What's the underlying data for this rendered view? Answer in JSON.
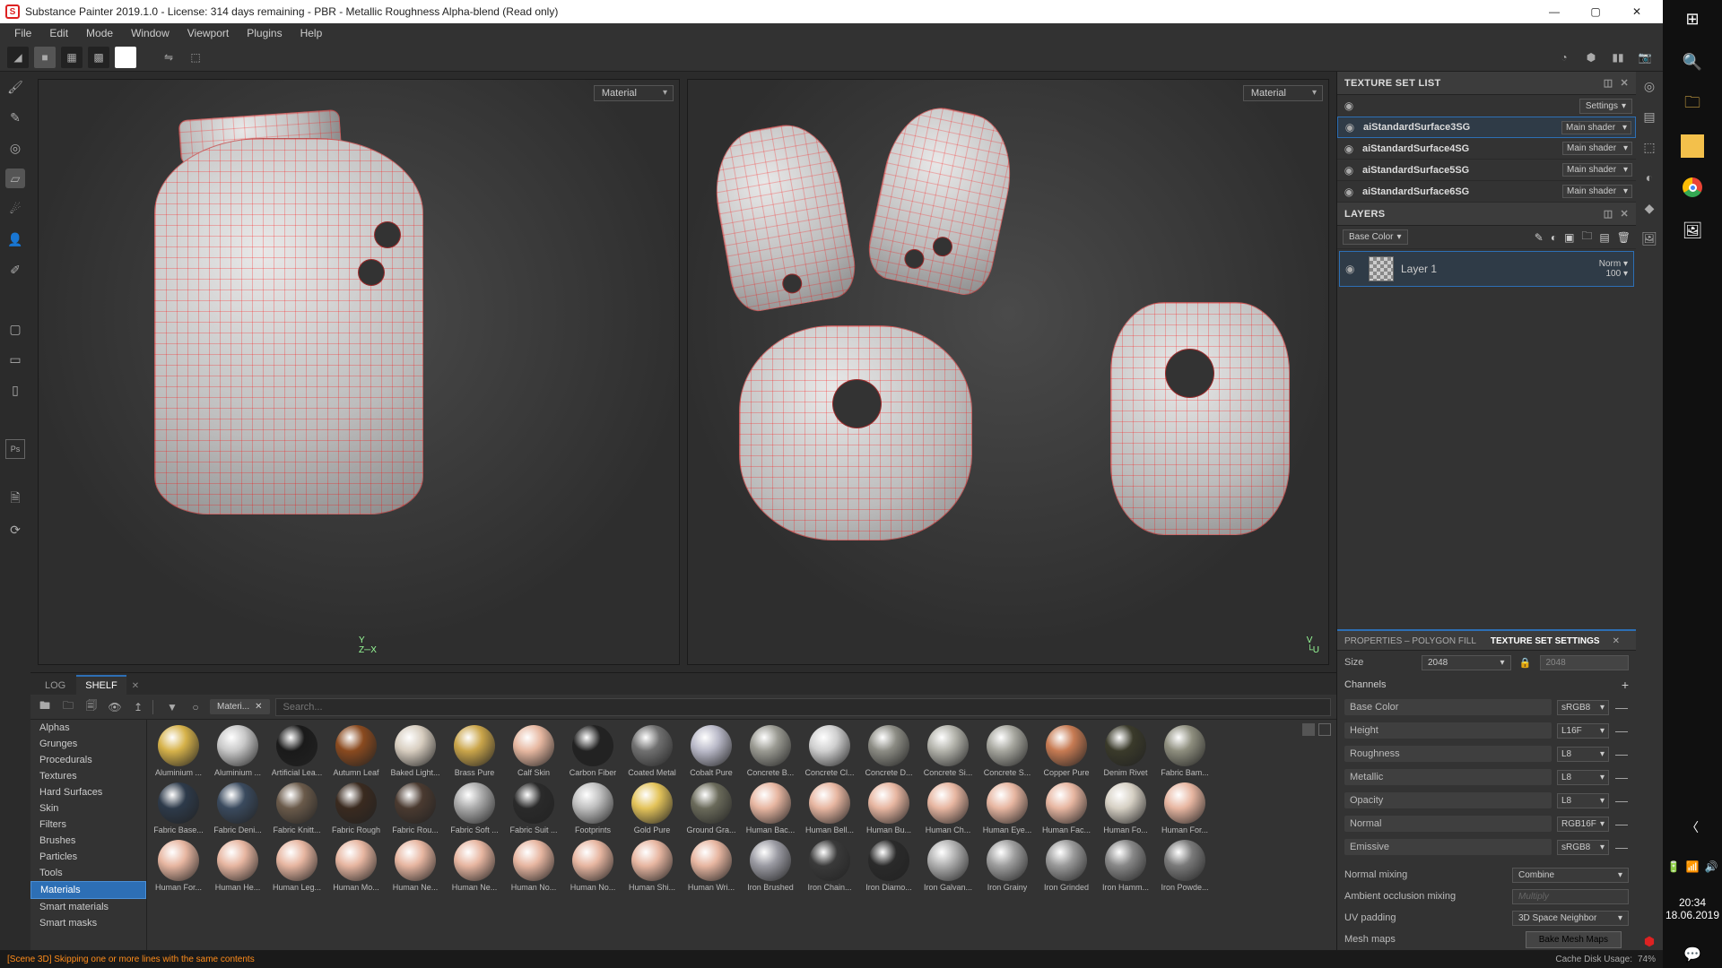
{
  "title": "Substance Painter 2019.1.0 - License: 314 days remaining - PBR - Metallic Roughness Alpha-blend (Read only)",
  "menu": [
    "File",
    "Edit",
    "Mode",
    "Window",
    "Viewport",
    "Plugins",
    "Help"
  ],
  "viewport": {
    "dd3d": "Material",
    "dd2d": "Material"
  },
  "texture_set_list": {
    "title": "TEXTURE SET LIST",
    "settings": "Settings",
    "items": [
      {
        "name": "aiStandardSurface3SG",
        "shader": "Main shader"
      },
      {
        "name": "aiStandardSurface4SG",
        "shader": "Main shader"
      },
      {
        "name": "aiStandardSurface5SG",
        "shader": "Main shader"
      },
      {
        "name": "aiStandardSurface6SG",
        "shader": "Main shader"
      }
    ]
  },
  "layers": {
    "title": "LAYERS",
    "channel": "Base Color",
    "layer_name": "Layer 1",
    "blend": "Norm",
    "opacity": "100"
  },
  "props": {
    "tab1": "PROPERTIES – POLYGON FILL",
    "tab2": "TEXTURE SET SETTINGS",
    "size_label": "Size",
    "size_val": "2048",
    "size_linked": "2048",
    "channels_label": "Channels",
    "channels": [
      {
        "name": "Base Color",
        "fmt": "sRGB8"
      },
      {
        "name": "Height",
        "fmt": "L16F"
      },
      {
        "name": "Roughness",
        "fmt": "L8"
      },
      {
        "name": "Metallic",
        "fmt": "L8"
      },
      {
        "name": "Opacity",
        "fmt": "L8"
      },
      {
        "name": "Normal",
        "fmt": "RGB16F"
      },
      {
        "name": "Emissive",
        "fmt": "sRGB8"
      }
    ],
    "normal_mixing_label": "Normal mixing",
    "normal_mixing": "Combine",
    "ao_label": "Ambient occlusion mixing",
    "ao_val": "Multiply",
    "uv_label": "UV padding",
    "uv_val": "3D Space Neighbor",
    "mesh_label": "Mesh maps",
    "bake": "Bake Mesh Maps"
  },
  "shelf": {
    "tab_log": "LOG",
    "tab_shelf": "SHELF",
    "filter_chip": "Materi...",
    "search_placeholder": "Search...",
    "categories": [
      "Alphas",
      "Grunges",
      "Procedurals",
      "Textures",
      "Hard Surfaces",
      "Skin",
      "Filters",
      "Brushes",
      "Particles",
      "Tools",
      "Materials",
      "Smart materials",
      "Smart masks"
    ],
    "selected_cat": "Materials",
    "rows": [
      [
        {
          "n": "Aluminium ...",
          "c": "#d6b24a"
        },
        {
          "n": "Aluminium ...",
          "c": "#c8c8c8"
        },
        {
          "n": "Artificial Lea...",
          "c": "#1a1a1a"
        },
        {
          "n": "Autumn Leaf",
          "c": "#8a4a1f"
        },
        {
          "n": "Baked Light...",
          "c": "#d7cdbf"
        },
        {
          "n": "Brass Pure",
          "c": "#caa54a"
        },
        {
          "n": "Calf Skin",
          "c": "#e6b7a0"
        },
        {
          "n": "Carbon Fiber",
          "c": "#222"
        },
        {
          "n": "Coated Metal",
          "c": "#707070"
        },
        {
          "n": "Cobalt Pure",
          "c": "#b9b9c8"
        },
        {
          "n": "Concrete B...",
          "c": "#9a9a92"
        },
        {
          "n": "Concrete Cl...",
          "c": "#cfcfcf"
        },
        {
          "n": "Concrete D...",
          "c": "#8c8c84"
        },
        {
          "n": "Concrete Si...",
          "c": "#b3b3ab"
        },
        {
          "n": "Concrete S...",
          "c": "#a6a69e"
        },
        {
          "n": "Copper Pure",
          "c": "#c77b53"
        },
        {
          "n": "Denim Rivet",
          "c": "#3a3a2a"
        },
        {
          "n": "Fabric Bam...",
          "c": "#8e8e7e"
        }
      ],
      [
        {
          "n": "Fabric Base...",
          "c": "#2d3a4a"
        },
        {
          "n": "Fabric Deni...",
          "c": "#3a4a5e"
        },
        {
          "n": "Fabric Knitt...",
          "c": "#6a5a4a"
        },
        {
          "n": "Fabric Rough",
          "c": "#3a2a1f"
        },
        {
          "n": "Fabric Rou...",
          "c": "#4a3a30"
        },
        {
          "n": "Fabric Soft ...",
          "c": "#aaa"
        },
        {
          "n": "Fabric Suit ...",
          "c": "#2a2a2a"
        },
        {
          "n": "Footprints",
          "c": "#bfbfbf"
        },
        {
          "n": "Gold Pure",
          "c": "#e3c35a"
        },
        {
          "n": "Ground Gra...",
          "c": "#6a6a5a"
        },
        {
          "n": "Human Bac...",
          "c": "#e7b6a1"
        },
        {
          "n": "Human Bell...",
          "c": "#e7b6a1"
        },
        {
          "n": "Human Bu...",
          "c": "#e7b6a1"
        },
        {
          "n": "Human Ch...",
          "c": "#e7b6a1"
        },
        {
          "n": "Human Eye...",
          "c": "#e7b6a1"
        },
        {
          "n": "Human Fac...",
          "c": "#e7b6a1"
        },
        {
          "n": "Human Fo...",
          "c": "#d6d0c4"
        },
        {
          "n": "Human For...",
          "c": "#e7b6a1"
        }
      ],
      [
        {
          "n": "Human For...",
          "c": "#e7b6a1"
        },
        {
          "n": "Human He...",
          "c": "#e7b6a1"
        },
        {
          "n": "Human Leg...",
          "c": "#e7b6a1"
        },
        {
          "n": "Human Mo...",
          "c": "#e7b6a1"
        },
        {
          "n": "Human Ne...",
          "c": "#e7b6a1"
        },
        {
          "n": "Human Ne...",
          "c": "#e7b6a1"
        },
        {
          "n": "Human No...",
          "c": "#e7b6a1"
        },
        {
          "n": "Human No...",
          "c": "#e7b6a1"
        },
        {
          "n": "Human Shi...",
          "c": "#e7b6a1"
        },
        {
          "n": "Human Wri...",
          "c": "#e7b6a1"
        },
        {
          "n": "Iron Brushed",
          "c": "#9a9aa2"
        },
        {
          "n": "Iron Chain...",
          "c": "#3a3a3a"
        },
        {
          "n": "Iron Diamo...",
          "c": "#2a2a2a"
        },
        {
          "n": "Iron Galvan...",
          "c": "#b0b0b0"
        },
        {
          "n": "Iron Grainy",
          "c": "#9e9e9e"
        },
        {
          "n": "Iron Grinded",
          "c": "#9a9a9a"
        },
        {
          "n": "Iron Hamm...",
          "c": "#888888"
        },
        {
          "n": "Iron Powde...",
          "c": "#7a7a7a"
        }
      ]
    ]
  },
  "status": {
    "error": "[Scene 3D] Skipping one or more lines with the same contents",
    "cache": "Cache Disk Usage:",
    "cache_pct": "74%"
  },
  "win": {
    "time": "20:34",
    "date": "18.06.2019"
  }
}
